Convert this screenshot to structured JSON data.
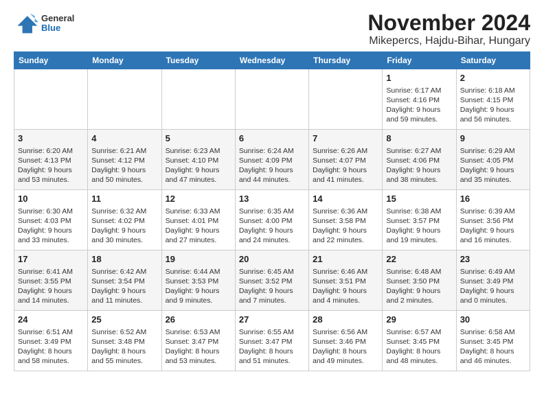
{
  "header": {
    "logo": {
      "general": "General",
      "blue": "Blue"
    },
    "title": "November 2024",
    "subtitle": "Mikepercs, Hajdu-Bihar, Hungary"
  },
  "calendar": {
    "days_of_week": [
      "Sunday",
      "Monday",
      "Tuesday",
      "Wednesday",
      "Thursday",
      "Friday",
      "Saturday"
    ],
    "weeks": [
      [
        {
          "day": "",
          "info": ""
        },
        {
          "day": "",
          "info": ""
        },
        {
          "day": "",
          "info": ""
        },
        {
          "day": "",
          "info": ""
        },
        {
          "day": "",
          "info": ""
        },
        {
          "day": "1",
          "info": "Sunrise: 6:17 AM\nSunset: 4:16 PM\nDaylight: 9 hours and 59 minutes."
        },
        {
          "day": "2",
          "info": "Sunrise: 6:18 AM\nSunset: 4:15 PM\nDaylight: 9 hours and 56 minutes."
        }
      ],
      [
        {
          "day": "3",
          "info": "Sunrise: 6:20 AM\nSunset: 4:13 PM\nDaylight: 9 hours and 53 minutes."
        },
        {
          "day": "4",
          "info": "Sunrise: 6:21 AM\nSunset: 4:12 PM\nDaylight: 9 hours and 50 minutes."
        },
        {
          "day": "5",
          "info": "Sunrise: 6:23 AM\nSunset: 4:10 PM\nDaylight: 9 hours and 47 minutes."
        },
        {
          "day": "6",
          "info": "Sunrise: 6:24 AM\nSunset: 4:09 PM\nDaylight: 9 hours and 44 minutes."
        },
        {
          "day": "7",
          "info": "Sunrise: 6:26 AM\nSunset: 4:07 PM\nDaylight: 9 hours and 41 minutes."
        },
        {
          "day": "8",
          "info": "Sunrise: 6:27 AM\nSunset: 4:06 PM\nDaylight: 9 hours and 38 minutes."
        },
        {
          "day": "9",
          "info": "Sunrise: 6:29 AM\nSunset: 4:05 PM\nDaylight: 9 hours and 35 minutes."
        }
      ],
      [
        {
          "day": "10",
          "info": "Sunrise: 6:30 AM\nSunset: 4:03 PM\nDaylight: 9 hours and 33 minutes."
        },
        {
          "day": "11",
          "info": "Sunrise: 6:32 AM\nSunset: 4:02 PM\nDaylight: 9 hours and 30 minutes."
        },
        {
          "day": "12",
          "info": "Sunrise: 6:33 AM\nSunset: 4:01 PM\nDaylight: 9 hours and 27 minutes."
        },
        {
          "day": "13",
          "info": "Sunrise: 6:35 AM\nSunset: 4:00 PM\nDaylight: 9 hours and 24 minutes."
        },
        {
          "day": "14",
          "info": "Sunrise: 6:36 AM\nSunset: 3:58 PM\nDaylight: 9 hours and 22 minutes."
        },
        {
          "day": "15",
          "info": "Sunrise: 6:38 AM\nSunset: 3:57 PM\nDaylight: 9 hours and 19 minutes."
        },
        {
          "day": "16",
          "info": "Sunrise: 6:39 AM\nSunset: 3:56 PM\nDaylight: 9 hours and 16 minutes."
        }
      ],
      [
        {
          "day": "17",
          "info": "Sunrise: 6:41 AM\nSunset: 3:55 PM\nDaylight: 9 hours and 14 minutes."
        },
        {
          "day": "18",
          "info": "Sunrise: 6:42 AM\nSunset: 3:54 PM\nDaylight: 9 hours and 11 minutes."
        },
        {
          "day": "19",
          "info": "Sunrise: 6:44 AM\nSunset: 3:53 PM\nDaylight: 9 hours and 9 minutes."
        },
        {
          "day": "20",
          "info": "Sunrise: 6:45 AM\nSunset: 3:52 PM\nDaylight: 9 hours and 7 minutes."
        },
        {
          "day": "21",
          "info": "Sunrise: 6:46 AM\nSunset: 3:51 PM\nDaylight: 9 hours and 4 minutes."
        },
        {
          "day": "22",
          "info": "Sunrise: 6:48 AM\nSunset: 3:50 PM\nDaylight: 9 hours and 2 minutes."
        },
        {
          "day": "23",
          "info": "Sunrise: 6:49 AM\nSunset: 3:49 PM\nDaylight: 9 hours and 0 minutes."
        }
      ],
      [
        {
          "day": "24",
          "info": "Sunrise: 6:51 AM\nSunset: 3:49 PM\nDaylight: 8 hours and 58 minutes."
        },
        {
          "day": "25",
          "info": "Sunrise: 6:52 AM\nSunset: 3:48 PM\nDaylight: 8 hours and 55 minutes."
        },
        {
          "day": "26",
          "info": "Sunrise: 6:53 AM\nSunset: 3:47 PM\nDaylight: 8 hours and 53 minutes."
        },
        {
          "day": "27",
          "info": "Sunrise: 6:55 AM\nSunset: 3:47 PM\nDaylight: 8 hours and 51 minutes."
        },
        {
          "day": "28",
          "info": "Sunrise: 6:56 AM\nSunset: 3:46 PM\nDaylight: 8 hours and 49 minutes."
        },
        {
          "day": "29",
          "info": "Sunrise: 6:57 AM\nSunset: 3:45 PM\nDaylight: 8 hours and 48 minutes."
        },
        {
          "day": "30",
          "info": "Sunrise: 6:58 AM\nSunset: 3:45 PM\nDaylight: 8 hours and 46 minutes."
        }
      ]
    ]
  }
}
